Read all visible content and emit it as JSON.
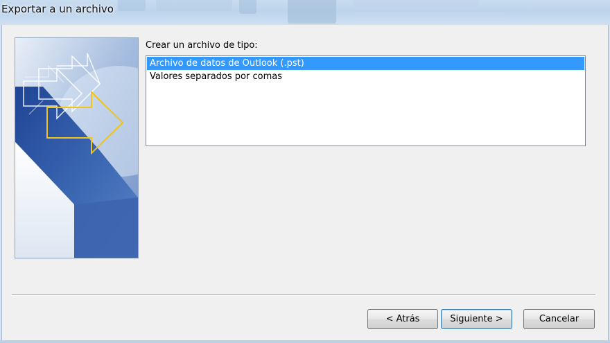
{
  "window": {
    "title": "Exportar a un archivo"
  },
  "main": {
    "prompt": "Crear un archivo de tipo:",
    "file_types": [
      {
        "label": "Archivo de datos de Outlook (.pst)",
        "selected": true
      },
      {
        "label": "Valores separados por comas",
        "selected": false
      }
    ]
  },
  "buttons": {
    "back": "< Atrás",
    "next": "Siguiente >",
    "cancel": "Cancelar"
  },
  "banner": {
    "icon": "export-wizard-arrows-illustration"
  },
  "colors": {
    "selection": "#3399ff",
    "banner_blue": "#2f5ca8",
    "arrow_outline": "#f0c419"
  }
}
